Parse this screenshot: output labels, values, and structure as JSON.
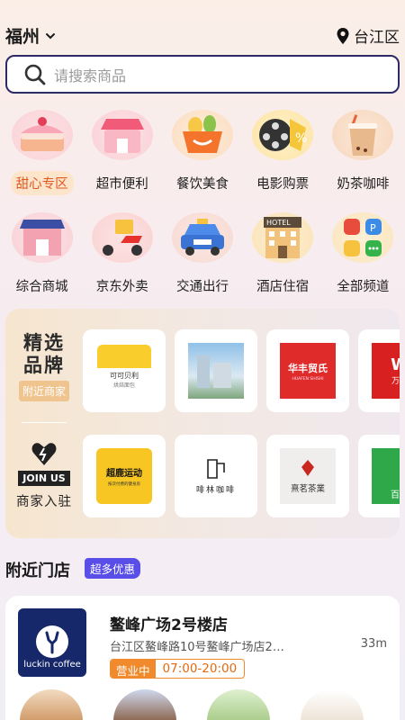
{
  "header": {
    "city": "福州",
    "location": "台江区"
  },
  "search": {
    "placeholder": "请搜索商品"
  },
  "categories_row1": [
    {
      "label": "甜心专区",
      "icon": "cake-icon",
      "active": true
    },
    {
      "label": "超市便利",
      "icon": "store-icon"
    },
    {
      "label": "餐饮美食",
      "icon": "food-basket-icon"
    },
    {
      "label": "电影购票",
      "icon": "film-reel-icon"
    },
    {
      "label": "奶茶咖啡",
      "icon": "milk-tea-icon"
    }
  ],
  "categories_row2": [
    {
      "label": "综合商城",
      "icon": "mall-icon"
    },
    {
      "label": "京东外卖",
      "icon": "delivery-scooter-icon"
    },
    {
      "label": "交通出行",
      "icon": "car-icon"
    },
    {
      "label": "酒店住宿",
      "icon": "hotel-icon"
    },
    {
      "label": "全部频道",
      "icon": "all-channels-icon"
    }
  ],
  "brands": {
    "title": "精选品牌",
    "tag": "附近商家",
    "join_label": "JOIN US",
    "join_sub": "商家入驻",
    "row1": [
      {
        "name": "可可贝利",
        "sub": "烘焙面包"
      },
      {
        "name": "building-photo"
      },
      {
        "name": "华丰贸氏",
        "sub": "HUAFEN SHISHI"
      },
      {
        "name": "万嘉"
      }
    ],
    "row2": [
      {
        "name": "超鹿运动",
        "sub": "按次付费的健身房"
      },
      {
        "name": "啡林咖啡"
      },
      {
        "name": "熹茗茶業"
      },
      {
        "name": "百果"
      }
    ]
  },
  "nearby": {
    "title": "附近门店",
    "badge": "超多优惠",
    "store": {
      "name": "鳌峰广场2号楼店",
      "address": "台江区鳌峰路10号鳌峰广场店2…",
      "distance": "33m",
      "status": "营业中",
      "hours": "07:00-20:00",
      "logo_text": "luckin coffee"
    }
  },
  "colors": {
    "accent": "#2e2a66",
    "orange": "#f08a2d",
    "purple": "#5a4ee8"
  }
}
